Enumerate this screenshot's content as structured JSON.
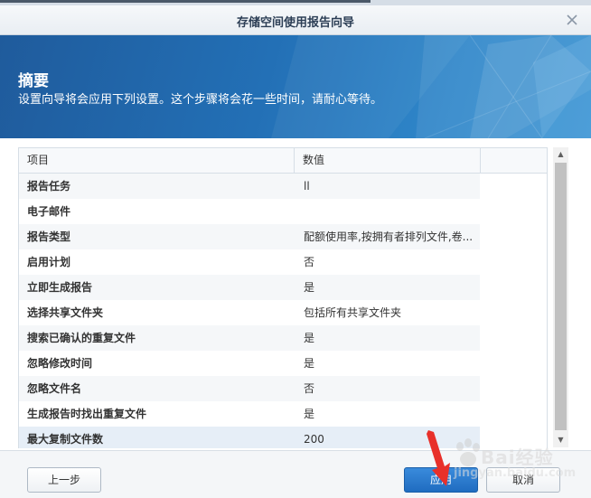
{
  "window": {
    "title": "存储空间使用报告向导",
    "close_label": "×"
  },
  "banner": {
    "heading": "摘要",
    "subtitle": "设置向导将会应用下列设置。这个步骤将会花一些时间，请耐心等待。"
  },
  "grid": {
    "columns": [
      "项目",
      "数值"
    ],
    "rows": [
      {
        "key": "报告任务",
        "value": "ll"
      },
      {
        "key": "电子邮件",
        "value": ""
      },
      {
        "key": "报告类型",
        "value": "配额使用率,按拥有者排列文件,卷..."
      },
      {
        "key": "启用计划",
        "value": "否"
      },
      {
        "key": "立即生成报告",
        "value": "是"
      },
      {
        "key": "选择共享文件夹",
        "value": "包括所有共享文件夹"
      },
      {
        "key": "搜索已确认的重复文件",
        "value": "是"
      },
      {
        "key": "忽略修改时间",
        "value": "是"
      },
      {
        "key": "忽略文件名",
        "value": "否"
      },
      {
        "key": "生成报告时找出重复文件",
        "value": "是"
      },
      {
        "key": "最大复制文件数",
        "value": "200"
      }
    ],
    "selected_row": 10
  },
  "scrollbar": {
    "up_arrow": "▲",
    "down_arrow": "▼"
  },
  "footer": {
    "back_label": "上一步",
    "apply_label": "应用",
    "cancel_label": "取消"
  },
  "watermark": {
    "text": "Bai经验",
    "url": "jingyan.baidu.com"
  },
  "colors": {
    "banner": "#2370b6",
    "apply_button": "#2a7bd0",
    "annotation_arrow": "#e8302a"
  }
}
